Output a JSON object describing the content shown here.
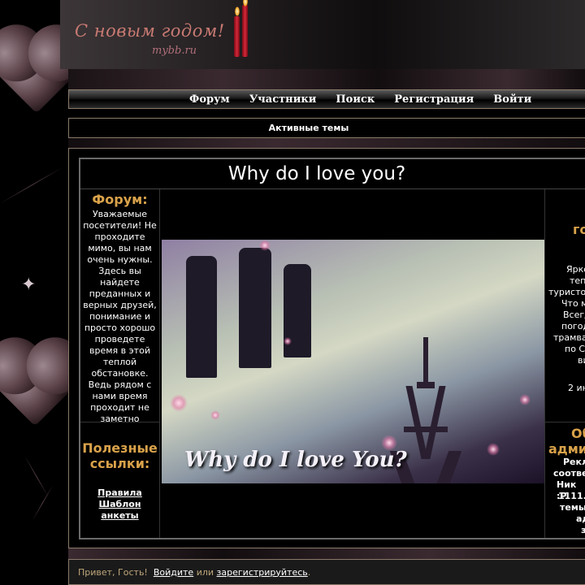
{
  "banner": {
    "title": "С новым годом!",
    "subtitle": "mybb.ru"
  },
  "nav": {
    "items": [
      {
        "label": "Форум"
      },
      {
        "label": "Участники"
      },
      {
        "label": "Поиск"
      },
      {
        "label": "Регистрация"
      },
      {
        "label": "Войти"
      }
    ]
  },
  "active_topics": {
    "label": "Активные темы"
  },
  "main": {
    "title": "Why do I love you?",
    "left": {
      "heading": "Форум:",
      "text": "Уважаемые посетители! Не проходите мимо, вы нам очень нужны. Здесь вы найдете преданных и верных друзей, понимание и просто хорошо проведете время в этой теплой обстановке. Ведь рядом с нами время проходит не заметно",
      "links_heading": "Полезные ссылки:",
      "links": [
        "Правила",
        "Шаблон анкеты"
      ]
    },
    "picture": {
      "caption": "Why do I love You?"
    },
    "right": {
      "top_lines": [
        "го",
        "Ярко",
        "теп",
        "туристо",
        "Что м",
        "Всегд",
        "погод",
        "трамва",
        "по С",
        "ви",
        "2 ин"
      ],
      "bottom_heading_lines": [
        "Об",
        "адми"
      ],
      "bottom_lines": [
        "Рекл",
        "соотве",
        "Ник :Р",
        "1111.",
        "темы",
        "ад",
        "з"
      ]
    }
  },
  "footer": {
    "greeting": "Привет, Гость!",
    "login": "Войдите",
    "or": "или",
    "register": "зарегистрируйтесь",
    "period": "."
  },
  "colors": {
    "heading_gold": "#d9a24a",
    "frame_border": "#8a7a6a",
    "footer_muted": "#bda57a"
  }
}
